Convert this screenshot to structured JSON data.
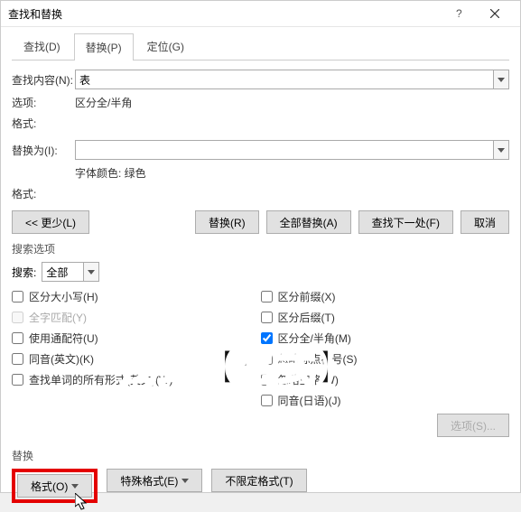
{
  "title": "查找和替换",
  "tabs": {
    "find": "查找(D)",
    "replace": "替换(P)",
    "goto": "定位(G)"
  },
  "labels": {
    "findWhat": "查找内容(N):",
    "options": "选项:",
    "format1": "格式:",
    "replaceWith": "替换为(I):",
    "format2": "格式:",
    "searchOptions": "搜索选项",
    "search": "搜索:",
    "replaceSection": "替换"
  },
  "values": {
    "findInput": "表",
    "optionsStatic": "区分全/半角",
    "replaceInput": "",
    "replaceFormat": "字体颜色: 绿色",
    "searchSelect": "全部"
  },
  "buttons": {
    "less": "<< 更少(L)",
    "replace": "替换(R)",
    "replaceAll": "全部替换(A)",
    "findNext": "查找下一处(F)",
    "cancel": "取消",
    "optionsBtn": "选项(S)...",
    "formatBtn": "格式(O)",
    "specialBtn": "特殊格式(E)",
    "noFormatBtn": "不限定格式(T)"
  },
  "checks": {
    "matchCase": "区分大小写(H)",
    "wholeWord": "全字匹配(Y)",
    "wildcards": "使用通配符(U)",
    "soundsLike": "同音(英文)(K)",
    "allWordForms": "查找单词的所有形式(英文)(W)",
    "prefix": "区分前缀(X)",
    "suffix": "区分后缀(T)",
    "fullHalf": "区分全/半角(M)",
    "ignorePunct": "忽略标点符号(S)",
    "ignoreSpace": "忽略空格(W)",
    "homophoneJp": "同音(日语)(J)"
  },
  "overlay": "找到【格式】"
}
